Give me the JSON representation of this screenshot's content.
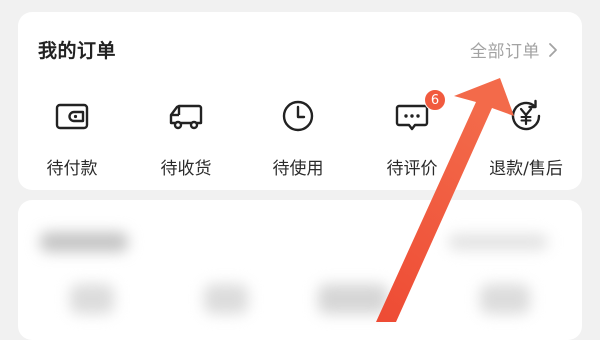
{
  "orders_card": {
    "title": "我的订单",
    "all_orders_label": "全部订单",
    "items": [
      {
        "label": "待付款",
        "icon": "wallet-icon"
      },
      {
        "label": "待收货",
        "icon": "truck-icon"
      },
      {
        "label": "待使用",
        "icon": "clock-icon"
      },
      {
        "label": "待评价",
        "icon": "comment-icon",
        "badge": "6"
      },
      {
        "label": "退款/售后",
        "icon": "refund-yuan-icon"
      }
    ]
  },
  "colors": {
    "accent": "#f15a3e",
    "text_primary": "#222222",
    "text_secondary": "#a3a3a3",
    "card_background": "#ffffff",
    "page_background": "#f1f1f1"
  }
}
